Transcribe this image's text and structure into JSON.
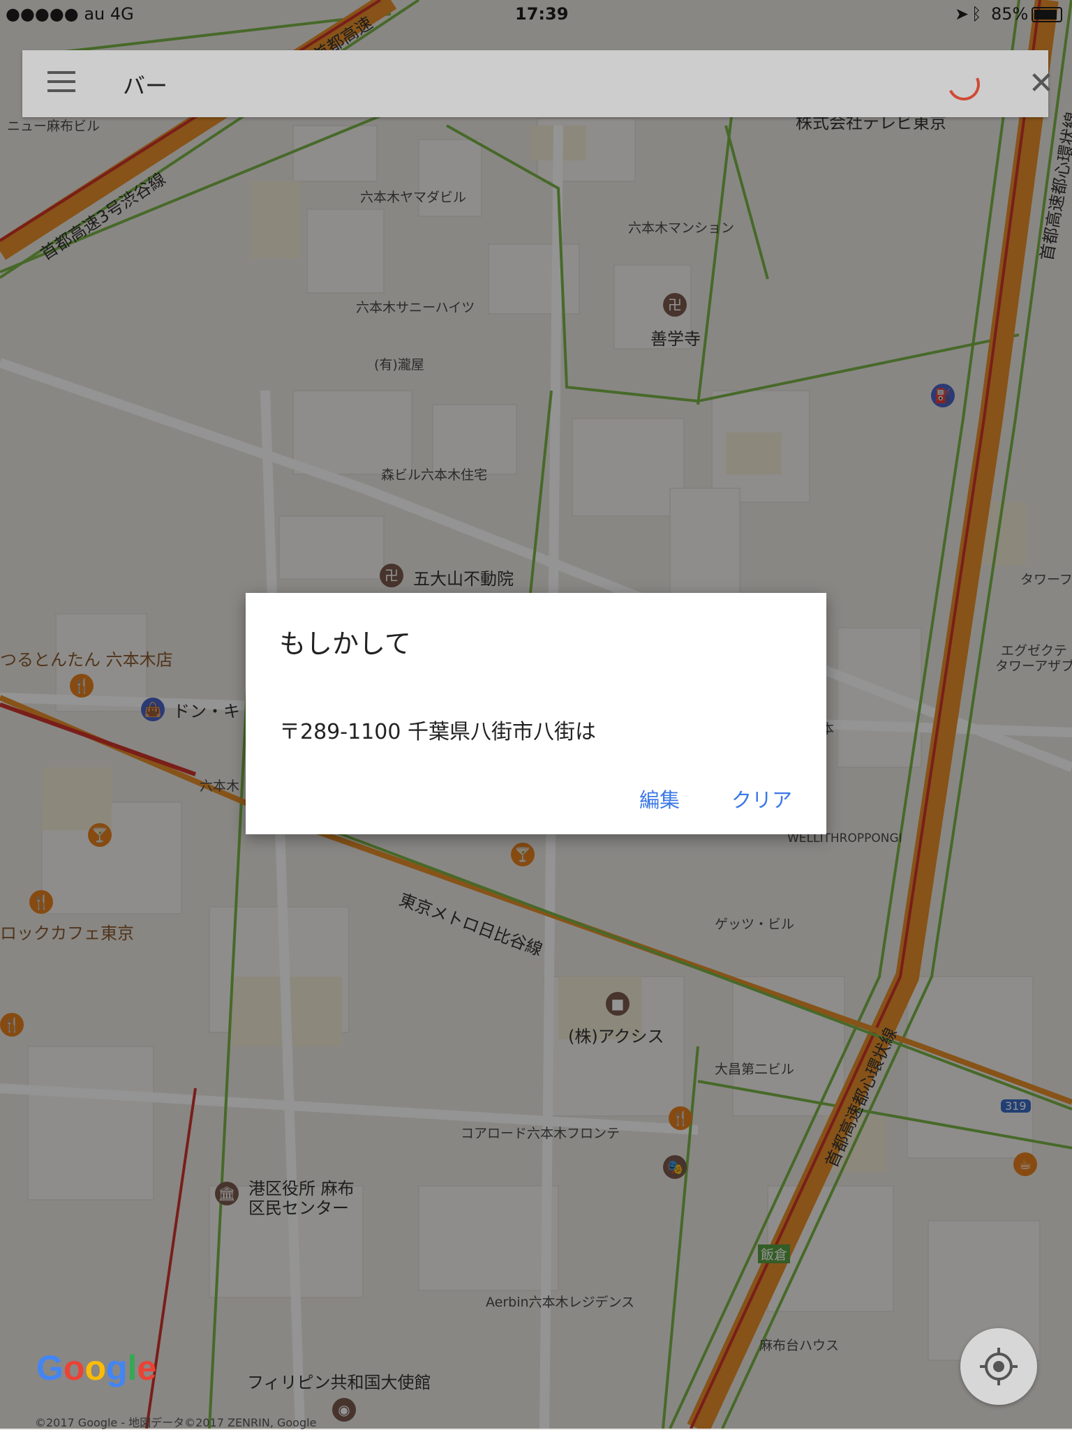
{
  "status_bar": {
    "carrier": "●●●●● au  4G",
    "time": "17:39",
    "battery": "85%"
  },
  "search": {
    "query": "バー",
    "menu_icon": "hamburger-menu-icon",
    "close_icon": "close-icon"
  },
  "map_labels": {
    "nyu_azabu": "ニュー麻布ビル",
    "yamadabiru": "六本木ヤマダビル",
    "mansion": "六本木マンション",
    "sunny": "六本木サニーハイツ",
    "zenkakuji": "善学寺",
    "takiya": "(有)瀧屋",
    "mori": "森ビル六本木住宅",
    "godaisan": "五大山不動院",
    "tsurutontan": "つるとんたん 六本木店",
    "donki": "ドン・キ",
    "roppongi_sign": "六本木",
    "rock_cafe": "ロックカフェ東京",
    "wellith": "WELLITHROPPONGI",
    "getty": "ゲッツ・ビル",
    "hibiya_line": "東京メトロ日比谷線",
    "axis": "(株)アクシス",
    "ohmasa": "大昌第二ビル",
    "coroad": "コアロード六本木フロンテ",
    "minato_ku_1": "港区役所 麻布",
    "minato_ku_2": "区民センター",
    "aerbin": "Aerbin六本木レジデンス",
    "azabudai": "麻布台ハウス",
    "philippines": "フィリピン共和国大使館",
    "iikura": "飯倉",
    "route319": "319",
    "tower": "タワーフ",
    "exe_1": "エグゼクテ",
    "exe_2": "タワーアザブ",
    "tv_tokyo": "株式会社テレビ東京",
    "highway_shibuya": "首都高速3号渋谷線",
    "highway_loop_top": "首都高速都心環状線",
    "highway_loop_bottom": "首都高速都心環状線",
    "highway_top": "首都高速",
    "hon_partial": "本"
  },
  "dialog": {
    "title": "もしかして",
    "message": "〒289-1100 千葉県八街市八街は",
    "edit_button": "編集",
    "clear_button": "クリア"
  },
  "footer": {
    "google_logo": "Google",
    "copyright": "©2017 Google - 地図データ©2017 ZENRIN, Google",
    "location_icon": "my-location-icon"
  },
  "colors": {
    "highway_orange": "#e8902a",
    "highway_red": "#d0342c",
    "road_green": "#7ab648",
    "accent_blue": "#3b78e7",
    "poi_orange": "#e8821e"
  }
}
